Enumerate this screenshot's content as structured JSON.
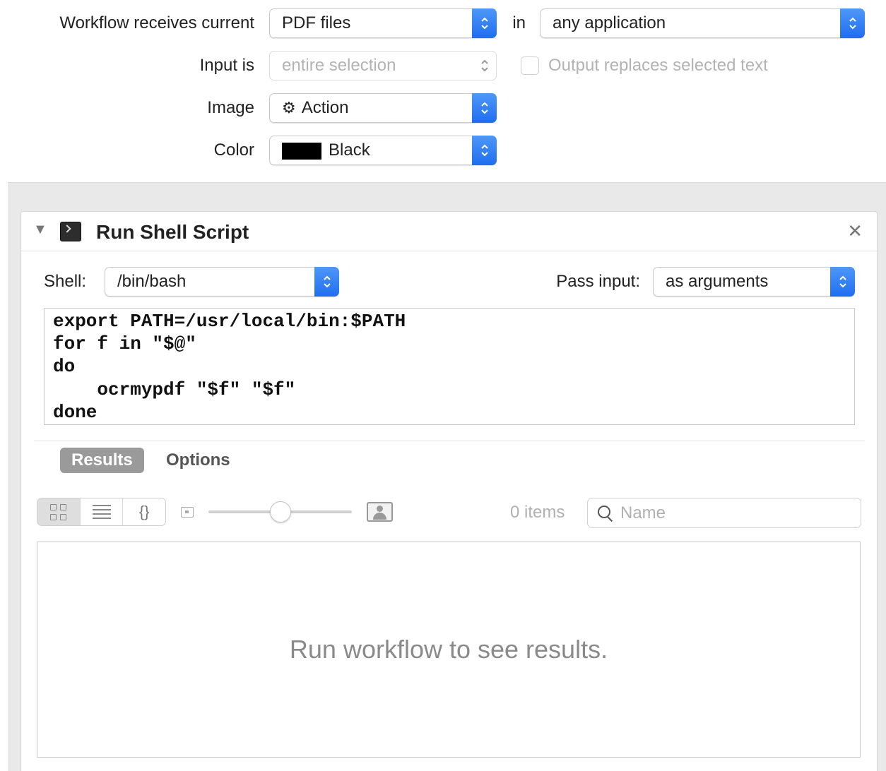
{
  "workflow_settings": {
    "receives_label": "Workflow receives current",
    "receives_value": "PDF files",
    "in_label": "in",
    "application_value": "any application",
    "input_is_label": "Input is",
    "input_is_value": "entire selection",
    "output_replaces_label": "Output replaces selected text",
    "output_replaces_checked": false,
    "image_label": "Image",
    "image_value": "Action",
    "image_icon": "gear-icon",
    "color_label": "Color",
    "color_value": "Black",
    "color_swatch": "#000000"
  },
  "action": {
    "title": "Run Shell Script",
    "icon": "terminal-icon",
    "shell_label": "Shell:",
    "shell_value": "/bin/bash",
    "pass_input_label": "Pass input:",
    "pass_input_value": "as arguments",
    "script": "export PATH=/usr/local/bin:$PATH\nfor f in \"$@\"\ndo\n    ocrmypdf \"$f\" \"$f\"\ndone",
    "tabs": [
      {
        "label": "Results",
        "active": true
      },
      {
        "label": "Options",
        "active": false
      }
    ],
    "view_modes": [
      "icon-view",
      "list-view",
      "json-view"
    ],
    "thumbnail_size": 0.5,
    "items_count": "0 items",
    "search_placeholder": "Name",
    "results_message": "Run workflow to see results."
  },
  "colors": {
    "accent_blue": "#2f7cf6",
    "panel_grey": "#e9e9e9"
  }
}
